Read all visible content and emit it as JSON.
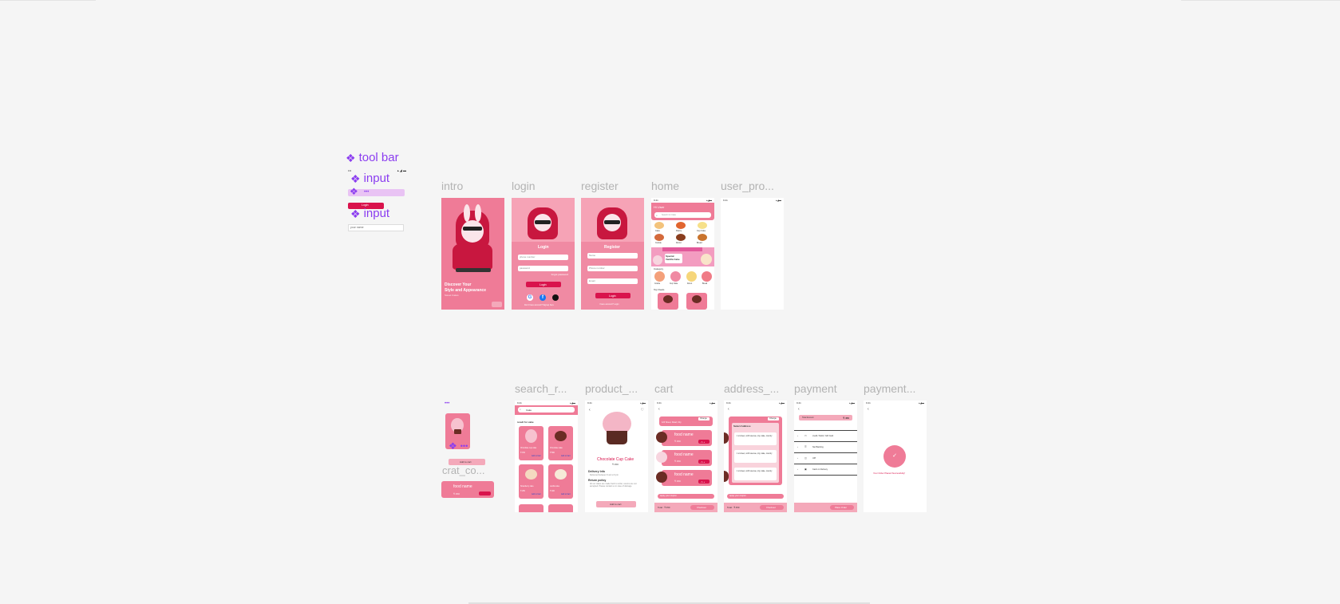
{
  "components": {
    "toolbar_label": "tool bar",
    "input_label_1": "input",
    "input_label_2": "input",
    "login_button_text": "Login",
    "input_sample_text": "your name",
    "crat_label": "crat_co...",
    "crat_food_name": "food name",
    "crat_price": "₹ 150",
    "add_cart_text": "Add to cart",
    "dots": "•••"
  },
  "frames": {
    "intro": {
      "label": "intro",
      "headline_line1": "Discover Your",
      "headline_line2": "Style and Appearance",
      "subtext": "Sweet Cakes"
    },
    "login": {
      "label": "login",
      "title": "Login",
      "email_placeholder": "phone number",
      "password_placeholder": "password",
      "forgot": "forgot password",
      "button": "Login",
      "signup_text": "Don't have account? Signup here"
    },
    "register": {
      "label": "register",
      "title": "Register",
      "name_placeholder": "Name",
      "phone_placeholder": "Phone number",
      "email_placeholder": "Email",
      "button": "Login",
      "login_text": "I have account? Login"
    },
    "home": {
      "label": "home",
      "greeting": "Hi User",
      "search_placeholder": "Search for Cake",
      "categories": [
        "Cake",
        "Pastry",
        "Cup Cake",
        "Cookie",
        "Donut",
        "Bread"
      ],
      "banner_text": "Special Vanilla Cake",
      "category_heading": "Category",
      "category_items": [
        "Cookie",
        "Cup Cake",
        "Donut",
        "Bread"
      ],
      "top_deals": "Top Deals",
      "deal_button": "Add to cart"
    },
    "user_profile": {
      "label": "user_pro..."
    },
    "search_result": {
      "label": "search_r...",
      "query": "Cake",
      "heading": "result for cake",
      "items": [
        {
          "name": "Chocolate cup cake",
          "price": "₹ 150",
          "action": "Add to Cart"
        },
        {
          "name": "Chocolate cake",
          "price": "₹ 500",
          "action": "Add to Cart"
        },
        {
          "name": "Strawberry cake",
          "price": "₹ 250",
          "action": "Add to Cart"
        },
        {
          "name": "vanilla cake",
          "price": "₹ 400",
          "action": "Add to Cart"
        }
      ]
    },
    "product_detail": {
      "label": "product_...",
      "product_name": "Chocolate Cup Cake",
      "price": "₹ 150",
      "delivery_heading": "Delivery Info",
      "delivery_text": "Delivered between 9 am to 9 pm",
      "return_heading": "Return policy",
      "return_text": "All our cakes are made fresh to order, returns are not accepted. Please contact us in case of damage.",
      "button": "Add to cart"
    },
    "cart": {
      "label": "cart",
      "address_button": "Change",
      "address_text": "123 Street, Road, City",
      "items": [
        {
          "name": "food name",
          "price": "₹ 150",
          "qty": "- 1 +"
        },
        {
          "name": "food name",
          "price": "₹ 150",
          "qty": "- 1 +"
        },
        {
          "name": "food name",
          "price": "₹ 150",
          "qty": "- 1 +"
        }
      ],
      "coupon": "Apply your coupon",
      "total": "Total : ₹ 450",
      "checkout": "Checkout"
    },
    "address": {
      "label": "address_...",
      "heading": "Select Address",
      "change": "Change",
      "addresses": [
        "1 st street, north avenue, city, state, country",
        "1 st street, north avenue, city, state, country",
        "1 st street, north avenue, city, state, country"
      ],
      "coupon": "Apply your coupon",
      "total": "Total : ₹ 450",
      "checkout": "Checkout"
    },
    "payment": {
      "label": "payment",
      "total_label": "Total Amount",
      "total_value": "₹ 450",
      "methods": [
        "credit / Debit / Gift Card",
        "Net Banking",
        "UPI",
        "Cash on Delivery"
      ],
      "button": "Place Order"
    },
    "payment_success": {
      "label": "payment...",
      "message": "Your Order Placed Successfully!"
    }
  },
  "colors": {
    "pink": "#ef7b97",
    "red": "#d9134c",
    "component_purple": "#8b3df0",
    "canvas": "#f5f5f5",
    "frame_label": "#b3b3b3"
  }
}
